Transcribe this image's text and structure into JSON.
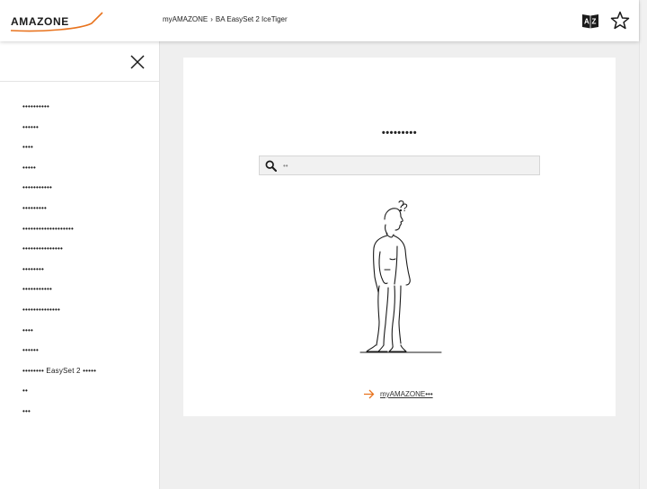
{
  "header": {
    "logo_text": "AMAZONE",
    "breadcrumb": [
      "myAMAZONE",
      "BA EasySet 2 IceTiger"
    ],
    "breadcrumb_separator": "›",
    "accent_color": "#e8731e"
  },
  "sidebar": {
    "items": [
      "••••••••••",
      "••••••",
      "••••",
      "•••••",
      "•••••••••••",
      "•••••••••",
      "•••••••••••••••••••",
      "•••••••••••••••",
      "••••••••",
      "•••••••••••",
      "••••••••••••••",
      "••••",
      "••••••",
      "•••••••• EasySet 2 •••••",
      "••",
      "•••"
    ]
  },
  "main": {
    "title": "•••••••••",
    "search_placeholder": "••",
    "home_link_label": "myAMAZONE•••"
  }
}
